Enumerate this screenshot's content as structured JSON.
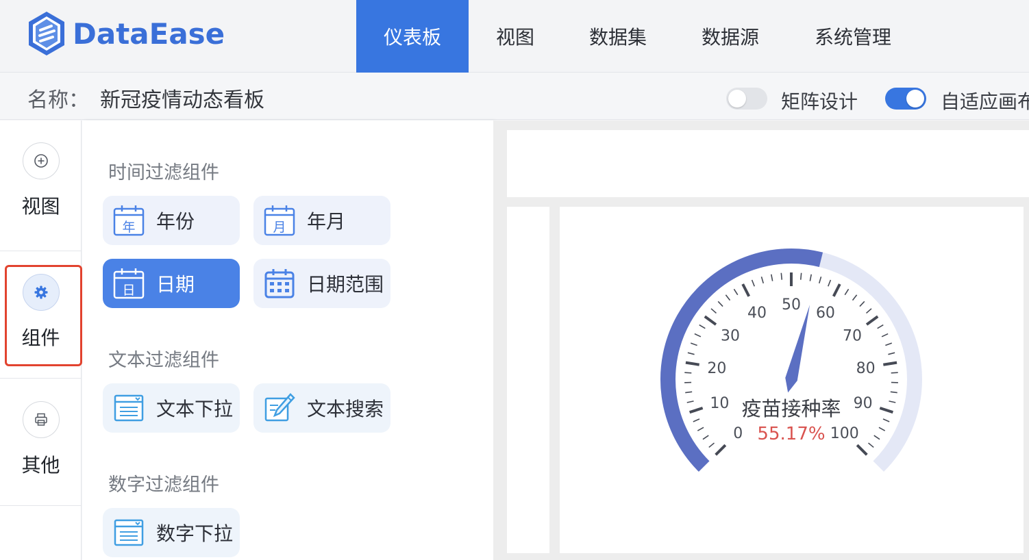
{
  "app": {
    "logo_text": "DataEase",
    "brand_color": "#3876e0"
  },
  "nav": {
    "items": [
      {
        "label": "仪表板",
        "active": true
      },
      {
        "label": "视图",
        "active": false
      },
      {
        "label": "数据集",
        "active": false
      },
      {
        "label": "数据源",
        "active": false
      },
      {
        "label": "系统管理",
        "active": false
      }
    ]
  },
  "namebar": {
    "name_label": "名称：",
    "name_value": "新冠疫情动态看板",
    "matrix_toggle": {
      "label": "矩阵设计",
      "on": false
    },
    "adaptive_toggle": {
      "label": "自适应画布",
      "on": true
    }
  },
  "rail": {
    "items": [
      {
        "label": "视图",
        "icon": "plus-circle-icon",
        "active": false
      },
      {
        "label": "组件",
        "icon": "gear-icon",
        "active": true
      },
      {
        "label": "其他",
        "icon": "print-icon",
        "active": false
      }
    ]
  },
  "panel": {
    "sections": [
      {
        "title": "时间过滤组件",
        "items": [
          {
            "label": "年份",
            "icon": "calendar-year-icon",
            "icon_char": "年",
            "active": false
          },
          {
            "label": "年月",
            "icon": "calendar-month-icon",
            "icon_char": "月",
            "active": false
          },
          {
            "label": "日期",
            "icon": "calendar-day-icon",
            "icon_char": "日",
            "active": true
          },
          {
            "label": "日期范围",
            "icon": "calendar-range-icon",
            "active": false
          }
        ]
      },
      {
        "title": "文本过滤组件",
        "items": [
          {
            "label": "文本下拉",
            "icon": "list-dropdown-icon",
            "active": false
          },
          {
            "label": "文本搜索",
            "icon": "edit-search-icon",
            "active": false
          }
        ]
      },
      {
        "title": "数字过滤组件",
        "items": [
          {
            "label": "数字下拉",
            "icon": "list-dropdown-icon",
            "active": false
          }
        ]
      }
    ]
  },
  "gauge": {
    "label": "疫苗接种率",
    "value_text": "55.17%",
    "value": 55.17,
    "min": 0,
    "max": 100,
    "tick_labels": [
      "0",
      "10",
      "20",
      "30",
      "40",
      "50",
      "60",
      "70",
      "80",
      "90",
      "100"
    ],
    "colors": {
      "progress": "#5b6fc2",
      "track": "#e4e8f6",
      "value": "#d9534f",
      "ticks": "#464a55"
    }
  }
}
